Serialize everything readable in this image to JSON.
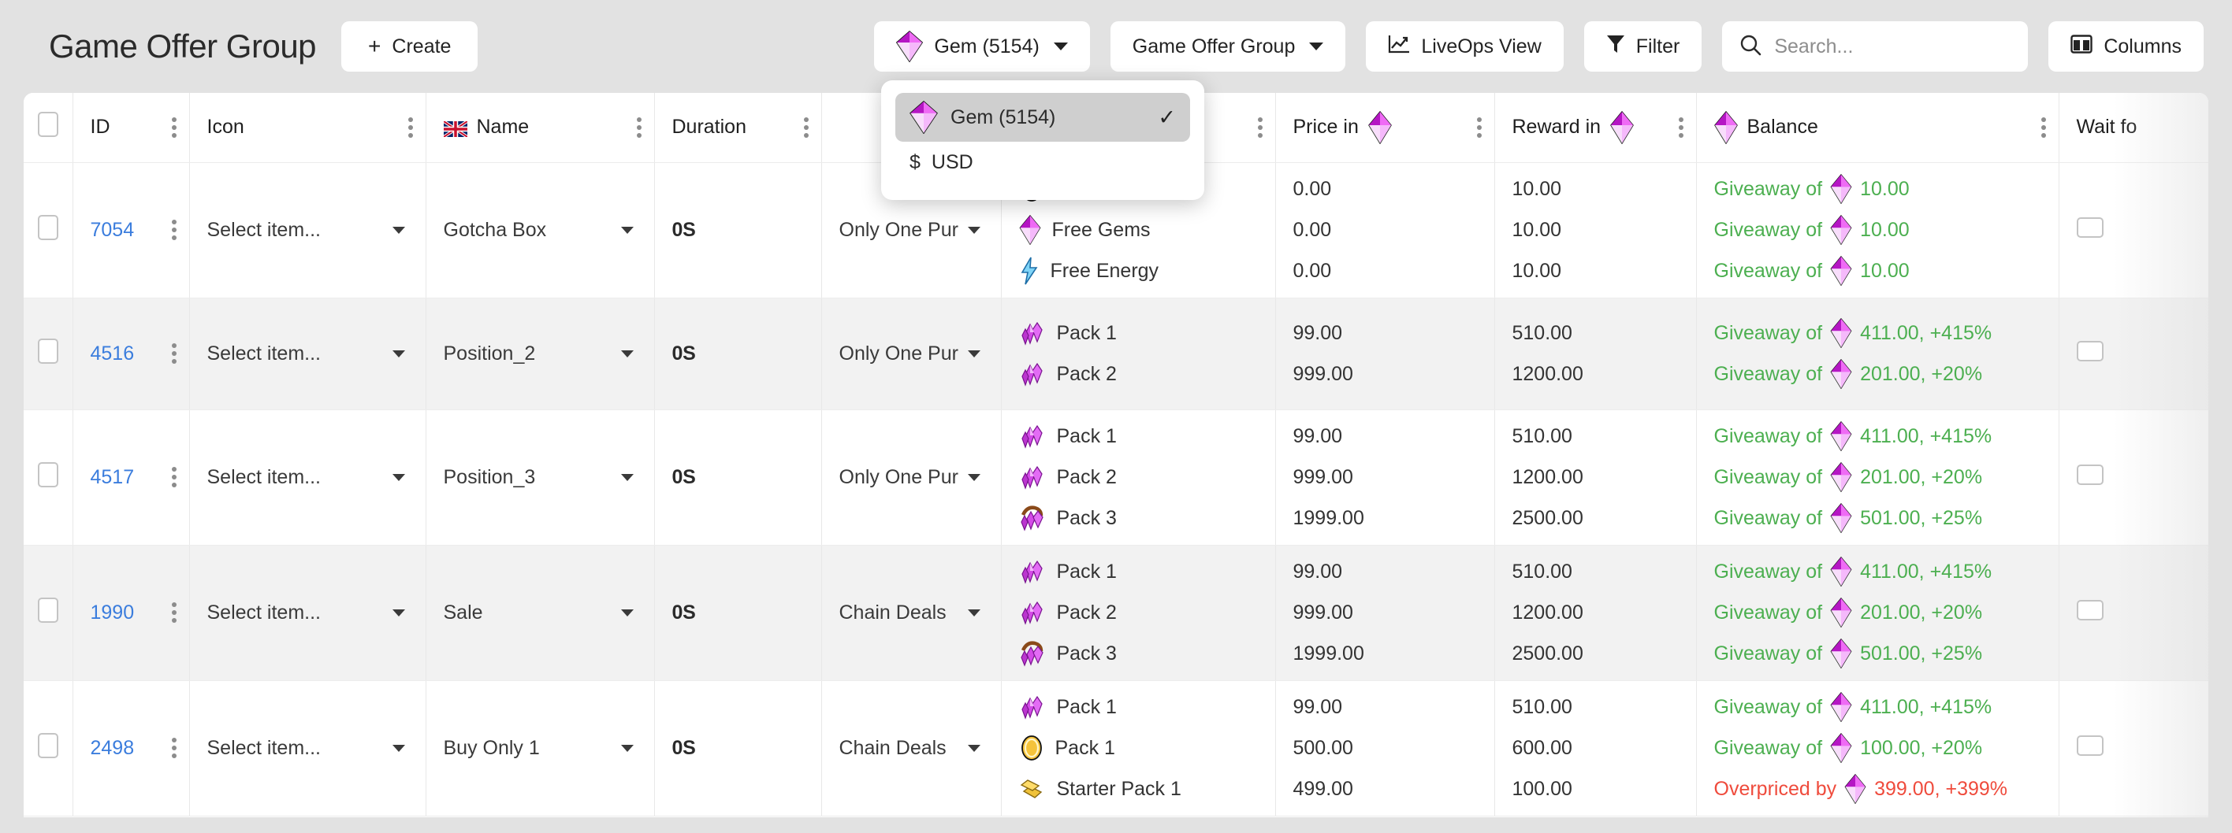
{
  "header": {
    "title": "Game Offer Group",
    "create_label": "Create",
    "create_icon": "plus-icon"
  },
  "toolbar": {
    "currency_selector": {
      "label": "Gem (5154)",
      "icon": "gem-icon",
      "chevron": "chevron-down-icon"
    },
    "group_selector": {
      "label": "Game Offer Group",
      "chevron": "chevron-down-icon"
    },
    "liveops": {
      "label": "LiveOps View",
      "icon": "chart-line-icon"
    },
    "filter": {
      "label": "Filter",
      "icon": "funnel-icon"
    },
    "search": {
      "placeholder": "Search...",
      "value": "",
      "icon": "search-icon"
    },
    "columns": {
      "label": "Columns",
      "icon": "columns-icon"
    }
  },
  "currency_dropdown": {
    "open": true,
    "options": [
      {
        "label": "Gem (5154)",
        "icon": "gem-icon",
        "selected": true,
        "check": "check-icon"
      },
      {
        "label": "USD",
        "icon": "dollar-sign",
        "prefix": "$",
        "selected": false
      }
    ]
  },
  "table": {
    "columns": [
      {
        "key": "select",
        "label": "",
        "icon": "checkbox-icon"
      },
      {
        "key": "id",
        "label": "ID"
      },
      {
        "key": "icon",
        "label": "Icon"
      },
      {
        "key": "name",
        "label": "Name",
        "icon": "uk-flag-icon"
      },
      {
        "key": "duration",
        "label": "Duration"
      },
      {
        "key": "type",
        "label": ""
      },
      {
        "key": "items",
        "label": ""
      },
      {
        "key": "price_in",
        "label": "Price in",
        "icon": "gem-icon"
      },
      {
        "key": "reward_in",
        "label": "Reward in",
        "icon": "gem-icon"
      },
      {
        "key": "balance",
        "label": "Balance",
        "icon": "gem-icon"
      },
      {
        "key": "wait_for",
        "label": "Wait fo"
      }
    ],
    "select_placeholder": "Select item...",
    "rows": [
      {
        "id": "7054",
        "icon_select": "Select item...",
        "name": "Gotcha Box",
        "duration": "0S",
        "type": "Only One Pur",
        "items": [
          {
            "icon": "coin-icon",
            "label": "",
            "price": "0.00",
            "reward": "10.00",
            "balance_text": "Giveaway of",
            "balance_value": "10.00",
            "balance_state": "green",
            "hidden_by_dropdown": true
          },
          {
            "icon": "gem-icon",
            "label": "Free Gems",
            "price": "0.00",
            "reward": "10.00",
            "balance_text": "Giveaway of",
            "balance_value": "10.00",
            "balance_state": "green"
          },
          {
            "icon": "energy-icon",
            "label": "Free Energy",
            "price": "0.00",
            "reward": "10.00",
            "balance_text": "Giveaway of",
            "balance_value": "10.00",
            "balance_state": "green"
          }
        ],
        "wait_for": false
      },
      {
        "id": "4516",
        "icon_select": "Select item...",
        "name": "Position_2",
        "duration": "0S",
        "type": "Only One Pur",
        "items": [
          {
            "icon": "gem-pack-icon",
            "label": "Pack 1",
            "price": "99.00",
            "reward": "510.00",
            "balance_text": "Giveaway of",
            "balance_value": "411.00, +415%",
            "balance_state": "green"
          },
          {
            "icon": "gem-pack-icon",
            "label": "Pack 2",
            "price": "999.00",
            "reward": "1200.00",
            "balance_text": "Giveaway of",
            "balance_value": "201.00, +20%",
            "balance_state": "green"
          }
        ],
        "wait_for": false
      },
      {
        "id": "4517",
        "icon_select": "Select item...",
        "name": "Position_3",
        "duration": "0S",
        "type": "Only One Pur",
        "items": [
          {
            "icon": "gem-pack-icon",
            "label": "Pack 1",
            "price": "99.00",
            "reward": "510.00",
            "balance_text": "Giveaway of",
            "balance_value": "411.00, +415%",
            "balance_state": "green"
          },
          {
            "icon": "gem-pack-icon",
            "label": "Pack 2",
            "price": "999.00",
            "reward": "1200.00",
            "balance_text": "Giveaway of",
            "balance_value": "201.00, +20%",
            "balance_state": "green"
          },
          {
            "icon": "gem-chest-icon",
            "label": "Pack 3",
            "price": "1999.00",
            "reward": "2500.00",
            "balance_text": "Giveaway of",
            "balance_value": "501.00, +25%",
            "balance_state": "green"
          }
        ],
        "wait_for": false
      },
      {
        "id": "1990",
        "icon_select": "Select item...",
        "name": "Sale",
        "duration": "0S",
        "type": "Chain Deals",
        "items": [
          {
            "icon": "gem-pack-icon",
            "label": "Pack 1",
            "price": "99.00",
            "reward": "510.00",
            "balance_text": "Giveaway of",
            "balance_value": "411.00, +415%",
            "balance_state": "green"
          },
          {
            "icon": "gem-pack-icon",
            "label": "Pack 2",
            "price": "999.00",
            "reward": "1200.00",
            "balance_text": "Giveaway of",
            "balance_value": "201.00, +20%",
            "balance_state": "green"
          },
          {
            "icon": "gem-chest-icon",
            "label": "Pack 3",
            "price": "1999.00",
            "reward": "2500.00",
            "balance_text": "Giveaway of",
            "balance_value": "501.00, +25%",
            "balance_state": "green"
          }
        ],
        "wait_for": false
      },
      {
        "id": "2498",
        "icon_select": "Select item...",
        "name": "Buy Only 1",
        "duration": "0S",
        "type": "Chain Deals",
        "items": [
          {
            "icon": "gem-pack-icon",
            "label": "Pack 1",
            "price": "99.00",
            "reward": "510.00",
            "balance_text": "Giveaway of",
            "balance_value": "411.00, +415%",
            "balance_state": "green"
          },
          {
            "icon": "coin-icon",
            "label": "Pack 1",
            "price": "500.00",
            "reward": "600.00",
            "balance_text": "Giveaway of",
            "balance_value": "100.00, +20%",
            "balance_state": "green"
          },
          {
            "icon": "gold-bar-icon",
            "label": "Starter Pack 1",
            "price": "499.00",
            "reward": "100.00",
            "balance_text": "Overpriced by",
            "balance_value": "399.00, +399%",
            "balance_state": "red"
          }
        ],
        "wait_for": false
      }
    ]
  },
  "colors": {
    "accent_gem": "#cf2ee0",
    "link": "#3b7ddd",
    "green": "#4caf50",
    "red": "#ef4b3c",
    "page_bg": "#e2e2e2"
  }
}
